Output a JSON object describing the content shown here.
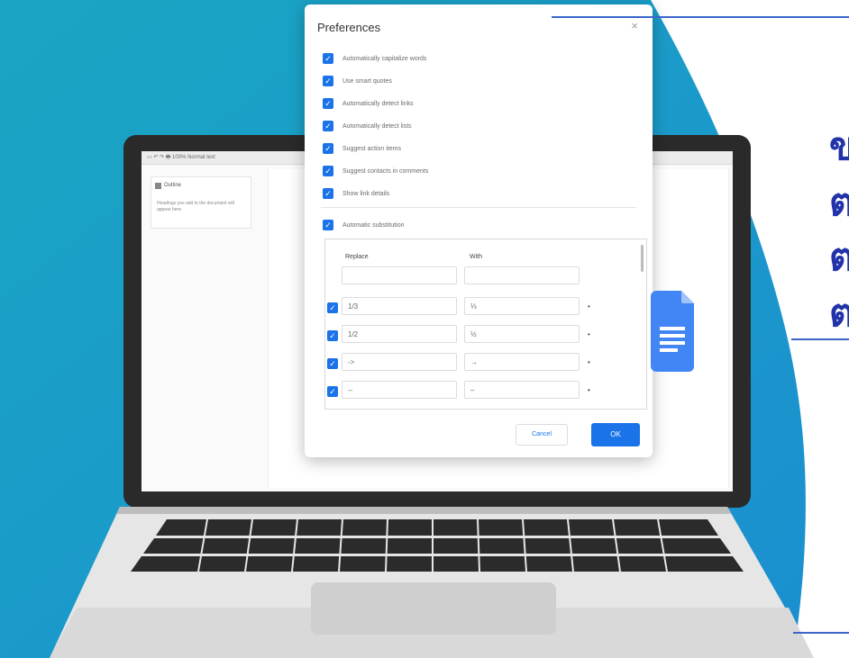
{
  "dialog": {
    "title": "Preferences",
    "close": "×",
    "options": [
      "Automatically capitalize words",
      "Use smart quotes",
      "Automatically detect links",
      "Automatically detect lists",
      "Suggest action items",
      "Suggest contacts in comments",
      "Show link details"
    ],
    "automatic_substitution": "Automatic substitution",
    "columns": {
      "replace": "Replace",
      "with": "With"
    },
    "substitutions": [
      {
        "replace": "1/3",
        "with": "⅓"
      },
      {
        "replace": "1/2",
        "with": "½"
      },
      {
        "replace": "->",
        "with": "→"
      },
      {
        "replace": "--",
        "with": "–"
      }
    ],
    "cancel": "Cancel",
    "ok": "OK"
  },
  "doc": {
    "toolbar_text": "▭ ↶ ↷ 🖶   100%   Normal text",
    "outline_title": "Outline",
    "outline_note": "Headings you add to the document will appear here."
  },
  "side_text": [
    "ข",
    "ต",
    "ต",
    "ต"
  ],
  "colors": {
    "accent": "#1a73e8",
    "teal": "#16a3c4",
    "side_text": "#2233aa",
    "deco_line": "#3a66c9"
  },
  "icons": [
    "google-docs-icon",
    "checkbox-icon",
    "close-icon"
  ]
}
